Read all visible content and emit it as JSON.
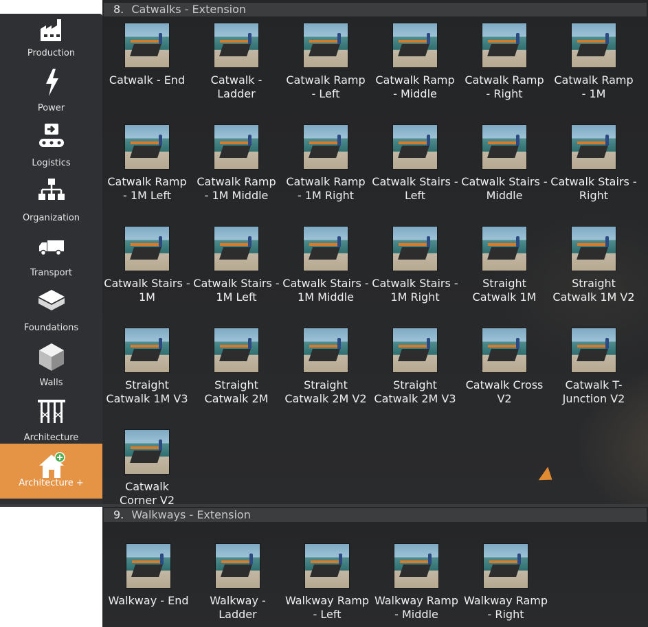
{
  "sidebar": {
    "items": [
      {
        "label": "Production",
        "icon": "factory-icon"
      },
      {
        "label": "Power",
        "icon": "lightning-icon"
      },
      {
        "label": "Logistics",
        "icon": "conveyor-icon"
      },
      {
        "label": "Organization",
        "icon": "hierarchy-icon"
      },
      {
        "label": "Transport",
        "icon": "truck-icon"
      },
      {
        "label": "Foundations",
        "icon": "foundation-icon"
      },
      {
        "label": "Walls",
        "icon": "wall-cube-icon"
      },
      {
        "label": "Architecture",
        "icon": "scaffold-icon"
      },
      {
        "label": "Architecture +",
        "icon": "house-plus-icon",
        "active": true
      }
    ]
  },
  "section8": {
    "number": "8.",
    "title": "Catwalks - Extension",
    "items": [
      "Catwalk - End",
      "Catwalk -\nLadder",
      "Catwalk Ramp\n- Left",
      "Catwalk Ramp\n- Middle",
      "Catwalk Ramp\n- Right",
      "Catwalk Ramp\n- 1M",
      "Catwalk Ramp\n- 1M Left",
      "Catwalk Ramp\n- 1M Middle",
      "Catwalk Ramp\n- 1M Right",
      "Catwalk Stairs -\nLeft",
      "Catwalk Stairs -\nMiddle",
      "Catwalk Stairs -\nRight",
      "Catwalk Stairs -\n1M",
      "Catwalk Stairs -\n1M Left",
      "Catwalk Stairs -\n1M Middle",
      "Catwalk Stairs -\n1M Right",
      "Straight\nCatwalk 1M",
      "Straight\nCatwalk 1M V2",
      "Straight\nCatwalk 1M V3",
      "Straight\nCatwalk 2M",
      "Straight\nCatwalk 2M V2",
      "Straight\nCatwalk 2M V3",
      "Catwalk Cross\nV2",
      "Catwalk T-\nJunction V2",
      "Catwalk\nCorner V2"
    ]
  },
  "section9": {
    "number": "9.",
    "title": "Walkways - Extension",
    "items": [
      "Walkway - End",
      "Walkway -\nLadder",
      "Walkway Ramp\n- Left",
      "Walkway Ramp\n- Middle",
      "Walkway Ramp\n- Right"
    ]
  },
  "colors": {
    "accent": "#e59345",
    "sidebar": "#2e3033",
    "panel": "#262729",
    "header": "#3c3d3f"
  }
}
